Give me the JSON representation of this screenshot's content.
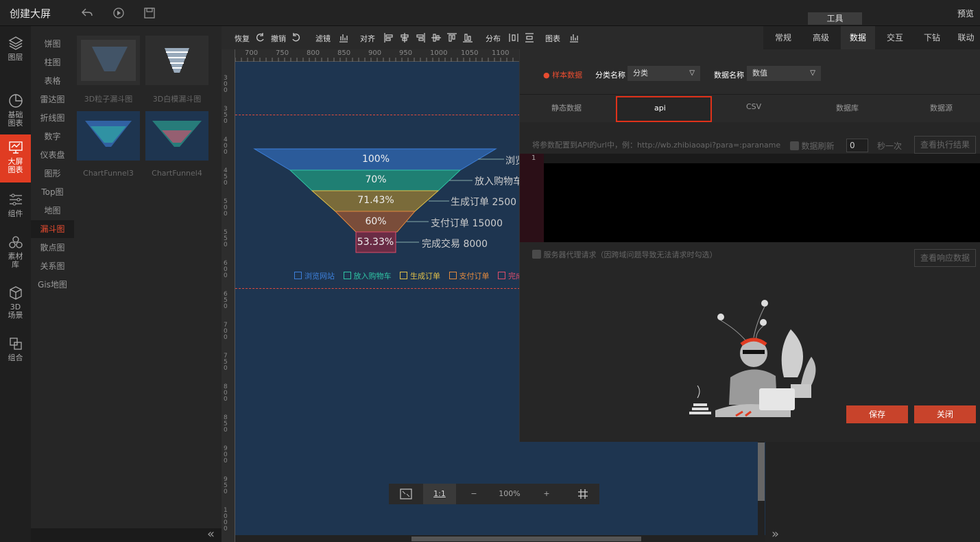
{
  "header": {
    "title": "创建大屏",
    "tool_tab": "工具",
    "preview": "预览"
  },
  "leftnav": [
    {
      "label": "图层"
    },
    {
      "label": "基础图表"
    },
    {
      "label": "大屏图表"
    },
    {
      "label": "组件"
    },
    {
      "label": "素材库"
    },
    {
      "label": "3D场景"
    },
    {
      "label": "组合"
    }
  ],
  "categories": [
    "饼图",
    "柱图",
    "表格",
    "雷达图",
    "折线图",
    "数字",
    "仪表盘",
    "图形",
    "Top图",
    "地图",
    "漏斗图",
    "散点图",
    "关系图",
    "Gis地图"
  ],
  "thumbnails": [
    "3D粒子漏斗图",
    "3D白模漏斗图",
    "ChartFunnel3",
    "ChartFunnel4"
  ],
  "toolbar": {
    "restore": "恢复",
    "undo": "撤销",
    "filter": "滤镜",
    "align": "对齐",
    "distribute": "分布",
    "chart": "图表"
  },
  "ruler_top": [
    "700",
    "750",
    "800",
    "850",
    "900",
    "950",
    "1000",
    "1050",
    "1100"
  ],
  "ruler_left": [
    "300",
    "350",
    "400",
    "450",
    "500",
    "550",
    "600",
    "650",
    "700",
    "750",
    "800",
    "850",
    "900",
    "950",
    "1000"
  ],
  "funnel": {
    "percents": [
      "100%",
      "70%",
      "71.43%",
      "60%",
      "53.33%"
    ],
    "labels": [
      "浏览",
      "放入购物车",
      "生成订单  2500",
      "支付订单  15000",
      "完成交易  8000"
    ],
    "legend": [
      "浏览网站",
      "放入购物车",
      "生成订单",
      "支付订单",
      "完成"
    ],
    "colors": [
      "#3d7fd9",
      "#2fc4a4",
      "#e0c04a",
      "#e38a3e",
      "#e04d6a"
    ]
  },
  "zoom": {
    "fit": "1:1",
    "minus": "−",
    "level": "100%",
    "plus": "+"
  },
  "right_tabs": [
    "常规",
    "高级",
    "数据",
    "交互",
    "下钻",
    "联动"
  ],
  "dialog": {
    "sample": "样本数据",
    "cat_name_label": "分类名称",
    "cat_value": "分类",
    "data_name_label": "数据名称",
    "data_value": "数值",
    "tabs": [
      "静态数据",
      "api",
      "CSV",
      "数据库",
      "数据源"
    ],
    "api_hint": "将参数配置到API的url中，例：http://wb.zhibiaoapi?para=:paraname",
    "refresh_label": "数据刷新",
    "refresh_value": "0",
    "refresh_unit": "秒一次",
    "view_exec": "查看执行结果",
    "line_no": "1",
    "proxy_label": "服务器代理请求（因跨域问题导致无法请求时勾选）",
    "view_resp": "查看响应数据",
    "save": "保存",
    "close": "关闭"
  }
}
